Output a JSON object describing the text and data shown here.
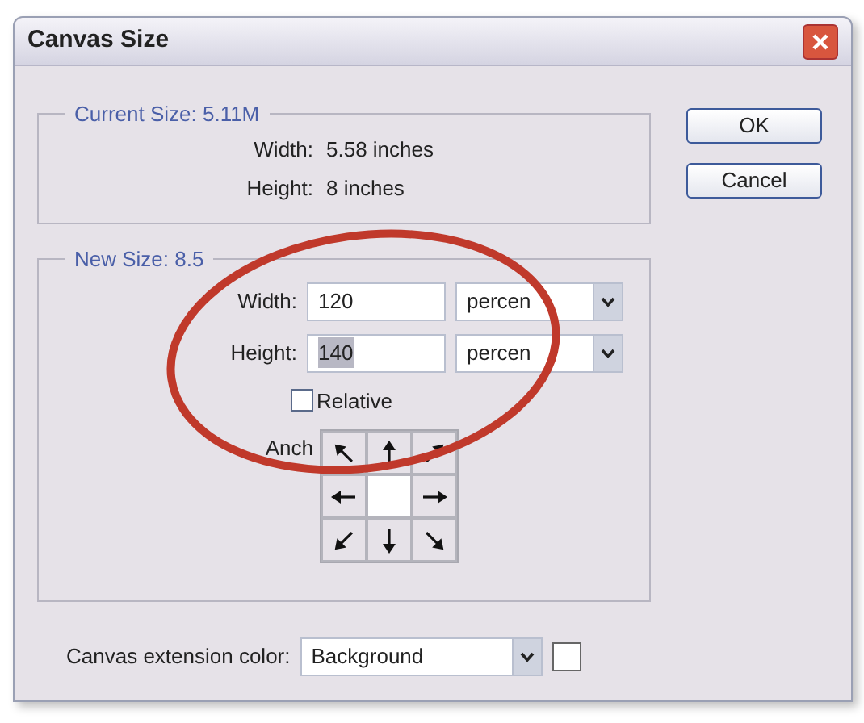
{
  "window": {
    "title": "Canvas Size"
  },
  "current_size": {
    "legend": "Current Size: 5.11M",
    "rows": [
      {
        "label": "Width:",
        "value": "5.58 inches"
      },
      {
        "label": "Height:",
        "value": "8 inches"
      }
    ]
  },
  "new_size": {
    "legend": "New Size: 8.5",
    "fields": [
      {
        "label": "Width:",
        "value": "120",
        "text_selected": false,
        "unit": "percen"
      },
      {
        "label": "Height:",
        "value": "140",
        "text_selected": true,
        "unit": "percen"
      }
    ],
    "relative": {
      "label": "Relative",
      "checked": false
    },
    "anchor": {
      "label": "Anch",
      "cells": [
        {
          "kind": "nw",
          "selected": false
        },
        {
          "kind": "n",
          "selected": false
        },
        {
          "kind": "ne",
          "selected": false
        },
        {
          "kind": "w",
          "selected": false
        },
        {
          "kind": "c",
          "selected": true
        },
        {
          "kind": "e",
          "selected": false
        },
        {
          "kind": "sw",
          "selected": false
        },
        {
          "kind": "s",
          "selected": false
        },
        {
          "kind": "se",
          "selected": false
        }
      ]
    }
  },
  "extension_color": {
    "label": "Canvas extension color:",
    "value": "Background"
  },
  "buttons": [
    "OK",
    "Cancel"
  ]
}
